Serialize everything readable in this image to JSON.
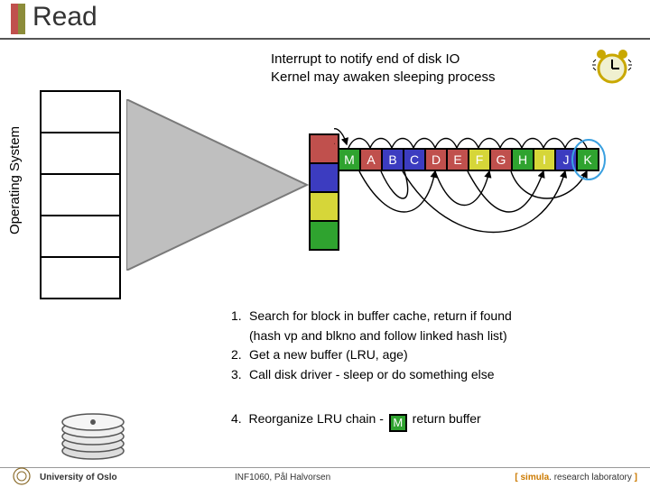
{
  "title": "Read",
  "interrupt": {
    "line1": "Interrupt to notify end of disk IO",
    "line2": "Kernel may awaken sleeping process"
  },
  "os_label": "Operating System",
  "lru_colors": [
    "#c0504d",
    "#3c3cc0",
    "#d6d639",
    "#2fa32f"
  ],
  "letters": [
    {
      "t": "M",
      "c": "#2fa32f"
    },
    {
      "t": "A",
      "c": "#c0504d"
    },
    {
      "t": "B",
      "c": "#3c3cc0"
    },
    {
      "t": "C",
      "c": "#3c3cc0"
    },
    {
      "t": "D",
      "c": "#c0504d"
    },
    {
      "t": "E",
      "c": "#c0504d"
    },
    {
      "t": "F",
      "c": "#d6d639"
    },
    {
      "t": "G",
      "c": "#c0504d"
    },
    {
      "t": "H",
      "c": "#2fa32f"
    },
    {
      "t": "I",
      "c": "#d6d639"
    },
    {
      "t": "J",
      "c": "#3c3cc0"
    },
    {
      "t": "K",
      "c": "#2fa32f"
    }
  ],
  "steps": {
    "s1": "Search for block in buffer cache, return if found",
    "s1b": "(hash vp and blkno and follow linked hash list)",
    "s2": "Get a new buffer (LRU, age)",
    "s3": "Call disk driver - sleep or do something else",
    "s4a": "Reorganize LRU chain -",
    "s4b": "return buffer",
    "s4chip": "M",
    "n1": "1.",
    "n2": "2.",
    "n3": "3.",
    "n4": "4."
  },
  "footer": {
    "uni": "University of Oslo",
    "course": "INF1060, Pål Halvorsen",
    "lab_sim": "simula",
    "lab_rest": ". research laboratory",
    "lb": "[ ",
    "rb": " ]"
  }
}
